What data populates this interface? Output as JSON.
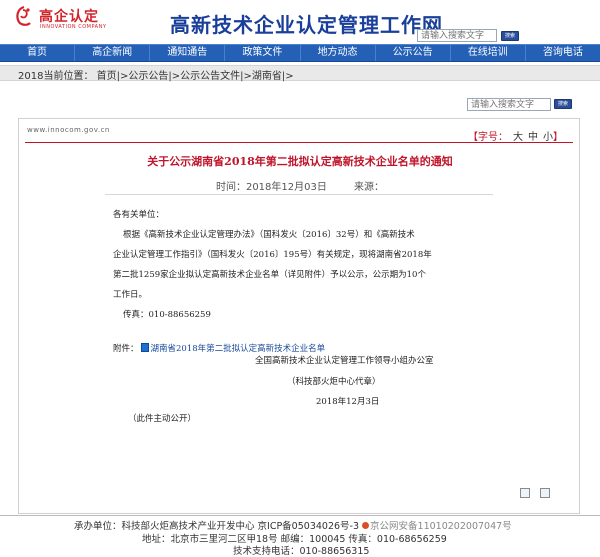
{
  "header": {
    "logo_text": "高企认定",
    "logo_sub": "INNOVATION COMPANY",
    "site_title": "高新技术企业认定管理工作网",
    "search": {
      "placeholder": "请输入搜索文字",
      "button_label": "搜索"
    }
  },
  "nav": {
    "items": [
      {
        "label": "首页"
      },
      {
        "label": "高企新闻"
      },
      {
        "label": "通知通告"
      },
      {
        "label": "政策文件"
      },
      {
        "label": "地方动态"
      },
      {
        "label": "公示公告"
      },
      {
        "label": "在线培训"
      },
      {
        "label": "咨询电话"
      }
    ]
  },
  "breadcrumb": {
    "prefix": "2018当前位置：",
    "path": "首页|>公示公告|>公示公告文件|>湖南省|>"
  },
  "search2": {
    "placeholder": "请输入搜索文字",
    "button_label": "搜索"
  },
  "article": {
    "site_url": "www.innocom.gov.cn",
    "font_size_label": "【字号：",
    "font_sizes": [
      "大",
      "中",
      "小"
    ],
    "font_size_close": "】",
    "title": "关于公示湖南省2018年第二批拟认定高新技术企业名单的通知",
    "time_label": "时间：",
    "time_value": "2018年12月03日",
    "source_label": "来源：",
    "greeting": "各有关单位：",
    "para1": "根据《高新技术企业认定管理办法》（国科发火〔2016〕32号）和《高新技术",
    "para2": "企业认定管理工作指引》（国科发火〔2016〕195号）有关规定，现将湖南省2018年",
    "para3": "第二批1259家企业拟认定高新技术企业名单（详见附件）予以公示，公示期为10个",
    "para4": "工作日。",
    "fax": "传真：010-88656259",
    "attach_label": "附件：",
    "attach_link": "湖南省2018年第二批拟认定高新技术企业名单",
    "sign_org": "全国高新技术企业认定管理工作领导小组办公室",
    "sign_sub": "（科技部火炬中心代章）",
    "sign_date": "2018年12月3日",
    "public_note": "（此件主动公开）"
  },
  "footer": {
    "line1_a": "承办单位：科技部火炬高技术产业开发中心 京ICP备05034026号-3",
    "line1_b": "京公网安备11010202007047号",
    "line2": "地址：北京市三里河二区甲18号 邮编：100045 传真：010-68656259",
    "line3": "技术支持电话：010-88656315"
  },
  "colors": {
    "nav_bg": "#2460b6",
    "title_red": "#c0142a",
    "site_title_blue": "#1a3f9a"
  }
}
